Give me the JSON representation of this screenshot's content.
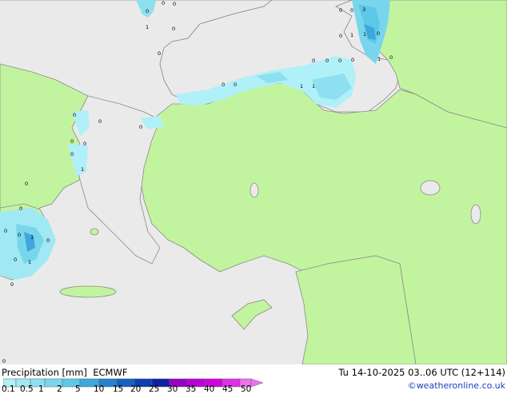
{
  "legend": {
    "title": "Precipitation [mm]",
    "model": "ECMWF",
    "ticks": [
      "0.1",
      "0.5",
      "1",
      "2",
      "5",
      "10",
      "15",
      "20",
      "25",
      "30",
      "35",
      "40",
      "45",
      "50"
    ],
    "colors": [
      "#b0f0f8",
      "#a0e8f4",
      "#8ee0f0",
      "#78d6ec",
      "#5ec8e8",
      "#3fa7dd",
      "#2383d2",
      "#1660c4",
      "#0d3fb4",
      "#1221a0",
      "#9a00c8",
      "#b800d8",
      "#d000e0",
      "#e030e8",
      "#f070f0"
    ]
  },
  "valid_time": "Tu 14-10-2025 03..06 UTC (12+114)",
  "credit": "©weatheronline.co.uk",
  "map_labels": [
    "0",
    "0",
    "0",
    "0",
    "1",
    "0",
    "0",
    "0",
    "3",
    "0",
    "1",
    "1",
    "0",
    "0",
    "1",
    "0",
    "0",
    "0",
    "0",
    "0",
    "0",
    "1",
    "1",
    "0",
    "0",
    "0",
    "0",
    "0",
    "0",
    "0",
    "1",
    "0",
    "0",
    "0",
    "1",
    "0",
    "0",
    "1",
    "0",
    "0"
  ],
  "colors": {
    "land": "#c2f4a0",
    "sea": "#eaeaea",
    "coast": "#8a8a8a"
  }
}
